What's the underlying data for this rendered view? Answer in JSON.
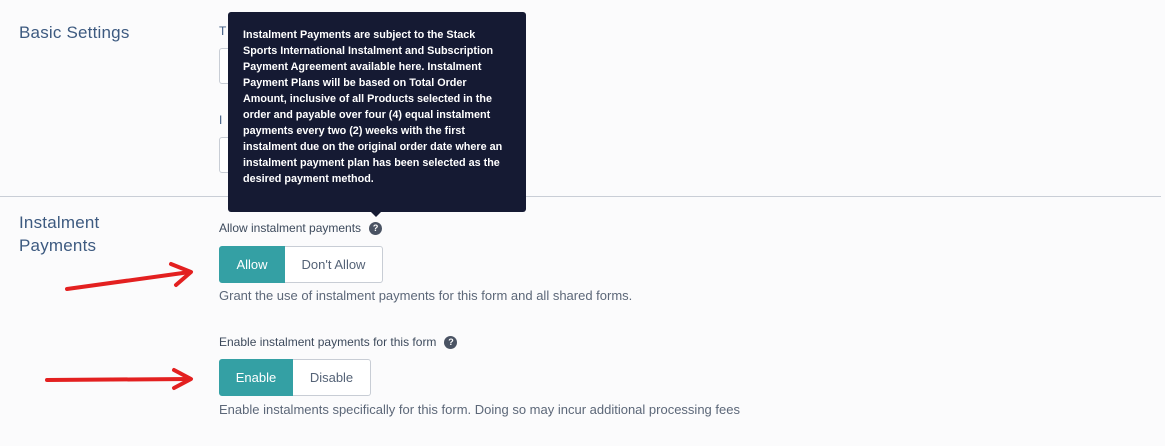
{
  "basic_settings": {
    "title": "Basic Settings",
    "stub_label_1": "T",
    "stub_label_2": "I"
  },
  "instalment_payments": {
    "title_line1": "Instalment",
    "title_line2": "Payments",
    "allow_field": {
      "label": "Allow instalment payments",
      "help_icon": "question-circle-icon",
      "options": [
        "Allow",
        "Don't Allow"
      ],
      "selected": "Allow",
      "hint": "Grant the use of instalment payments for this form and all shared forms."
    },
    "enable_field": {
      "label": "Enable instalment payments for this form",
      "help_icon": "question-circle-icon",
      "options": [
        "Enable",
        "Disable"
      ],
      "selected": "Enable",
      "hint": "Enable instalments specifically for this form. Doing so may incur additional processing fees"
    }
  },
  "tooltip": {
    "text": "Instalment Payments are subject to the Stack Sports International Instalment and Subscription Payment Agreement available here. Instalment Payment Plans will be based on Total Order Amount, inclusive of all Products selected in the order and payable over four (4) equal instalment payments every two (2) weeks with the first instalment due on the original order date where an instalment payment plan has been selected as the desired payment method."
  },
  "colors": {
    "accent": "#34a0a4",
    "tooltip_bg": "#151a33",
    "annotation_arrow": "#e32020"
  }
}
